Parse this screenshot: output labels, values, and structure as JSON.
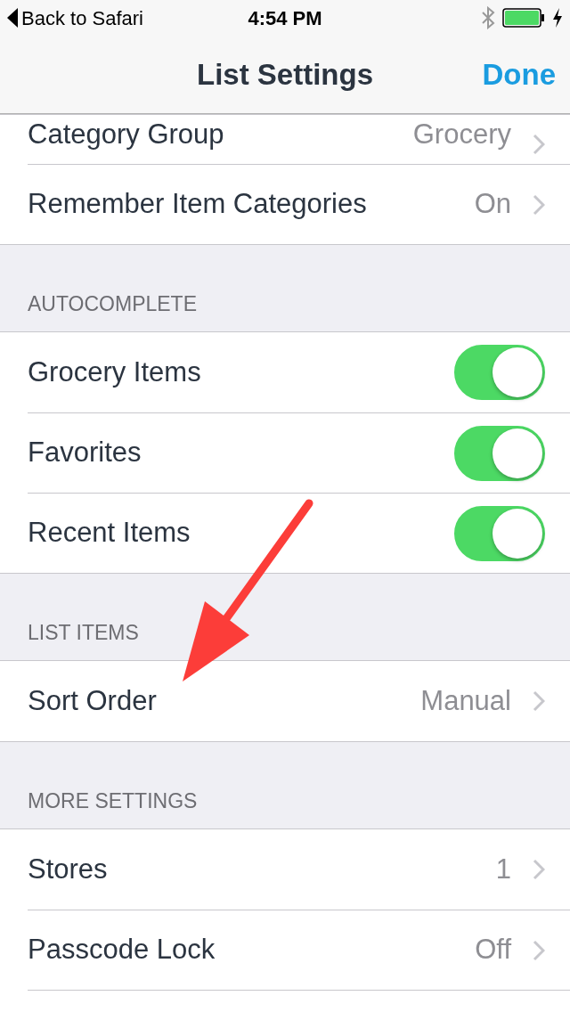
{
  "status_bar": {
    "back": "Back to Safari",
    "time": "4:54 PM"
  },
  "nav": {
    "title": "List Settings",
    "action": "Done"
  },
  "sections": [
    {
      "rows": [
        {
          "kind": "detail",
          "label": "Category Group",
          "value": "Grocery",
          "clipped": true
        },
        {
          "kind": "detail",
          "label": "Remember Item Categories",
          "value": "On"
        }
      ]
    },
    {
      "header": "AUTOCOMPLETE",
      "rows": [
        {
          "kind": "toggle",
          "label": "Grocery Items",
          "on": true
        },
        {
          "kind": "toggle",
          "label": "Favorites",
          "on": true
        },
        {
          "kind": "toggle",
          "label": "Recent Items",
          "on": true
        }
      ]
    },
    {
      "header": "LIST ITEMS",
      "rows": [
        {
          "kind": "detail",
          "label": "Sort Order",
          "value": "Manual"
        }
      ]
    },
    {
      "header": "MORE SETTINGS",
      "rows": [
        {
          "kind": "detail",
          "label": "Stores",
          "value": "1"
        },
        {
          "kind": "detail",
          "label": "Passcode Lock",
          "value": "Off"
        },
        {
          "kind": "stub"
        }
      ]
    }
  ]
}
